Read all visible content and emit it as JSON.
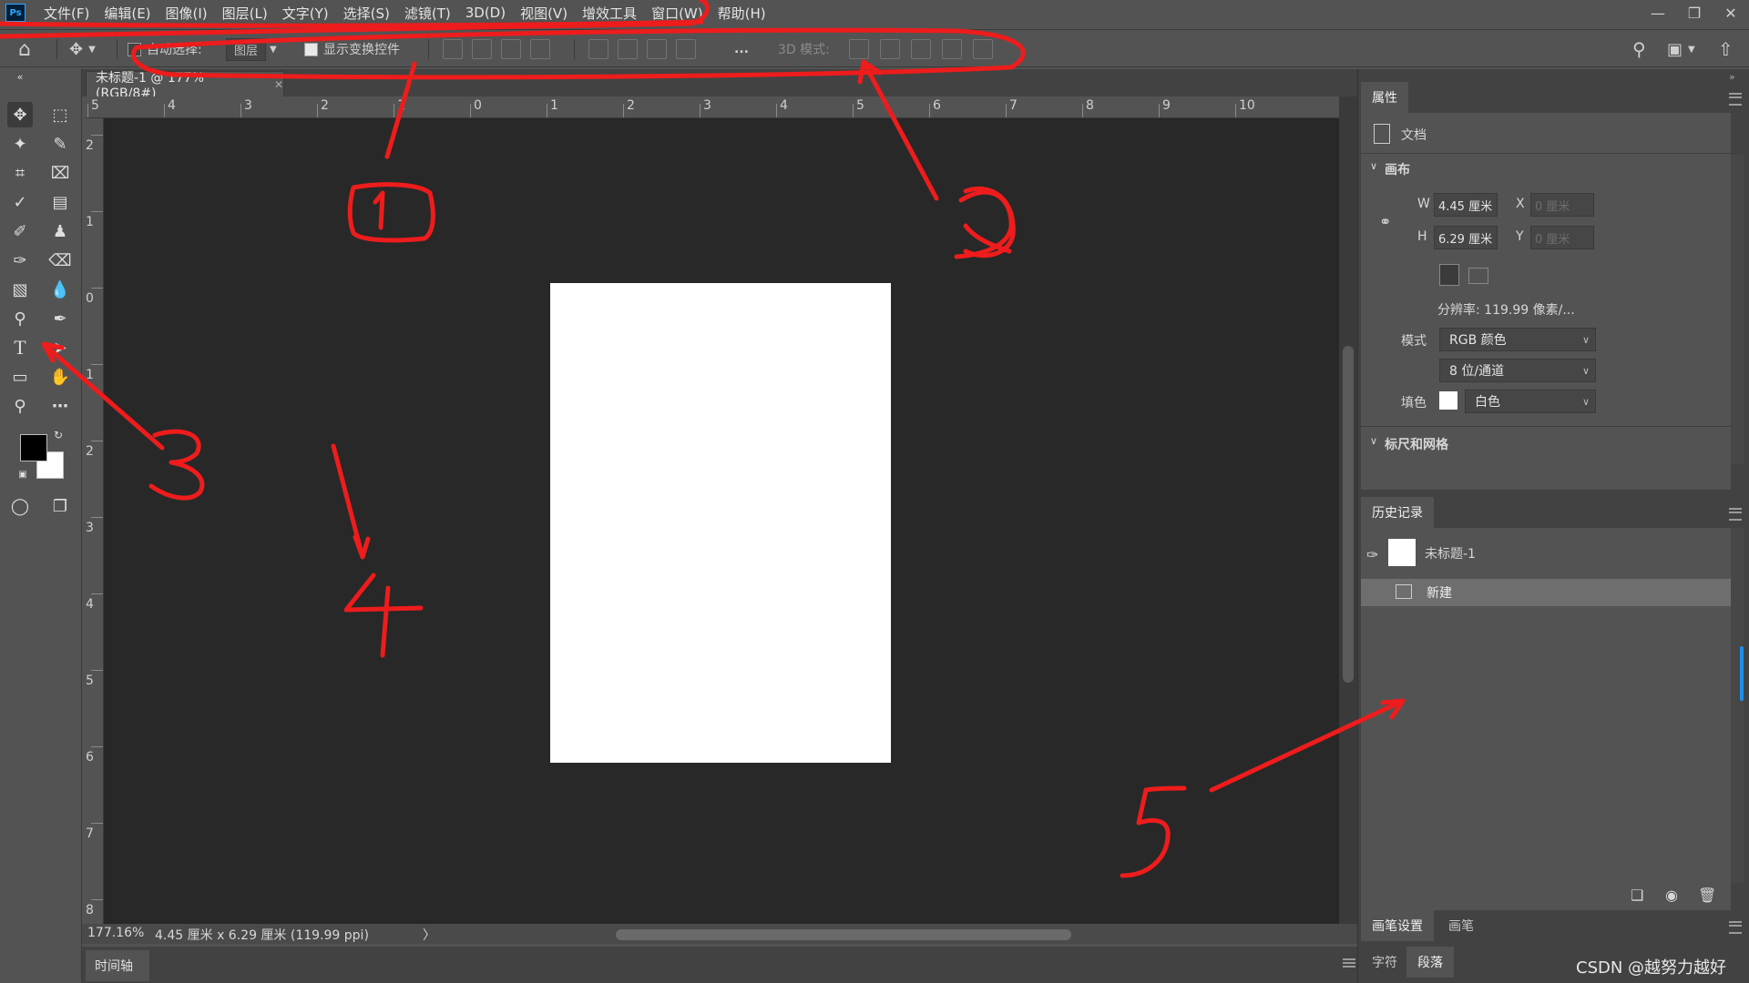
{
  "menubar": {
    "app_icon": "Ps",
    "items": [
      "文件(F)",
      "编辑(E)",
      "图像(I)",
      "图层(L)",
      "文字(Y)",
      "选择(S)",
      "滤镜(T)",
      "3D(D)",
      "视图(V)",
      "增效工具",
      "窗口(W)",
      "帮助(H)"
    ],
    "window_buttons": [
      "minimize-icon",
      "restore-icon",
      "close-icon"
    ]
  },
  "options_bar": {
    "auto_select_label": "自动选择:",
    "auto_select_target": "图层",
    "show_transform_label": "显示变换控件",
    "more": "...",
    "mode_3d_label": "3D 模式:"
  },
  "document": {
    "tab_title": "未标题-1 @ 177%(RGB/8#)",
    "page_color": "#ffffff",
    "canvas_bg": "#282828"
  },
  "rulers": {
    "top": [
      "5",
      "4",
      "3",
      "2",
      "1",
      "0",
      "1",
      "2",
      "3",
      "4",
      "5",
      "6",
      "7",
      "8",
      "9",
      "10"
    ],
    "left": [
      "2",
      "1",
      "0",
      "1",
      "2",
      "3",
      "4",
      "5",
      "6",
      "7",
      "8"
    ]
  },
  "status": {
    "zoom": "177.16%",
    "doc_info": "4.45 厘米 x 6.29 厘米 (119.99 ppi)",
    "arrow": "〉"
  },
  "timeline": {
    "tab": "时间轴"
  },
  "properties": {
    "tab": "属性",
    "doc_label": "文档",
    "section_canvas": "画布",
    "w_label": "W",
    "w_value": "4.45 厘米",
    "h_label": "H",
    "h_value": "6.29 厘米",
    "x_label": "X",
    "x_value": "0 厘米",
    "y_label": "Y",
    "y_value": "0 厘米",
    "resolution": "分辨率: 119.99 像素/...",
    "mode_label": "模式",
    "mode_value": "RGB 颜色",
    "depth_value": "8 位/通道",
    "fill_label": "填色",
    "fill_value": "白色",
    "section_rulers": "标尺和网格"
  },
  "history": {
    "tab": "历史记录",
    "snapshot_name": "未标题-1",
    "items": [
      "新建"
    ]
  },
  "brush_tabs": [
    "画笔设置",
    "画笔"
  ],
  "type_tabs": [
    "字符",
    "段落"
  ],
  "watermark": "CSDN @越努力越好",
  "annotations": [
    "1",
    "2",
    "3",
    "4",
    "5"
  ],
  "colors": {
    "ui_panel": "#535353",
    "ui_dark": "#424242",
    "annotation": "#ee1c1c",
    "foreground": "#000000",
    "background": "#ffffff"
  }
}
